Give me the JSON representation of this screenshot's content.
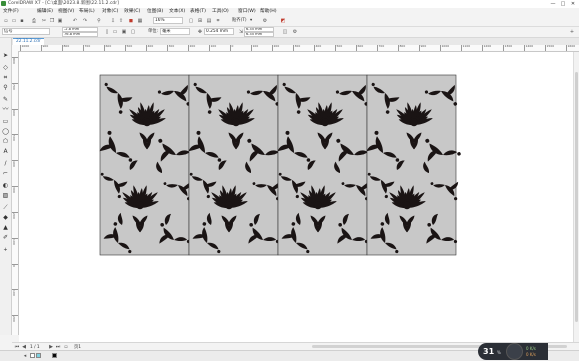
{
  "window": {
    "title": "CorelDRAW X7 - [C:\\桌面\\2023.8.新图\\22.11.2.cdr]",
    "controls": [
      "—",
      "□",
      "✕"
    ]
  },
  "menu": [
    "文件(F)",
    "编辑(E)",
    "视图(V)",
    "布局(L)",
    "对象(C)",
    "效果(C)",
    "位图(B)",
    "文本(X)",
    "表格(T)",
    "工具(O)",
    "窗口(W)",
    "帮助(H)"
  ],
  "toolbar": {
    "zoom_value": "16%",
    "snap_label": "贴齐(T)",
    "snap_arrow": "▾"
  },
  "property_bar": {
    "preset": "信号",
    "x_value": "-2.8 mm",
    "y_value": "76.8 mm",
    "unit_label": "单位:",
    "unit_value": "毫米",
    "nudge_value": "0.254 mm",
    "dup_x": "6.35 mm",
    "dup_y": "6.35 mm"
  },
  "document": {
    "tab_label": "22.11.2.cdr"
  },
  "ruler": {
    "h_labels": [
      "1000",
      "900",
      "800",
      "700",
      "600",
      "500",
      "400",
      "300",
      "200",
      "100",
      "0",
      "100",
      "200",
      "300",
      "400",
      "500",
      "600",
      "700",
      "800",
      "900",
      "1000",
      "1100",
      "1200",
      "1300",
      "1400",
      "1500",
      "1600"
    ],
    "v_labels": [
      "800",
      "700",
      "600",
      "500",
      "400",
      "300",
      "200",
      "100",
      "0",
      "100",
      "200"
    ]
  },
  "design": {
    "panel_fill": "#c8c8c8",
    "motif_fill": "#1a1414",
    "panel_count": 4
  },
  "page_nav": {
    "position": "1 / 1",
    "page_label": "页1"
  },
  "status": {
    "palette": [
      "#ffffff",
      "#7fd1e0",
      "#0a0a0a"
    ]
  },
  "speed_widget": {
    "value": "31",
    "unit": "%",
    "up": "0 K/s",
    "down": "0 K/s"
  }
}
